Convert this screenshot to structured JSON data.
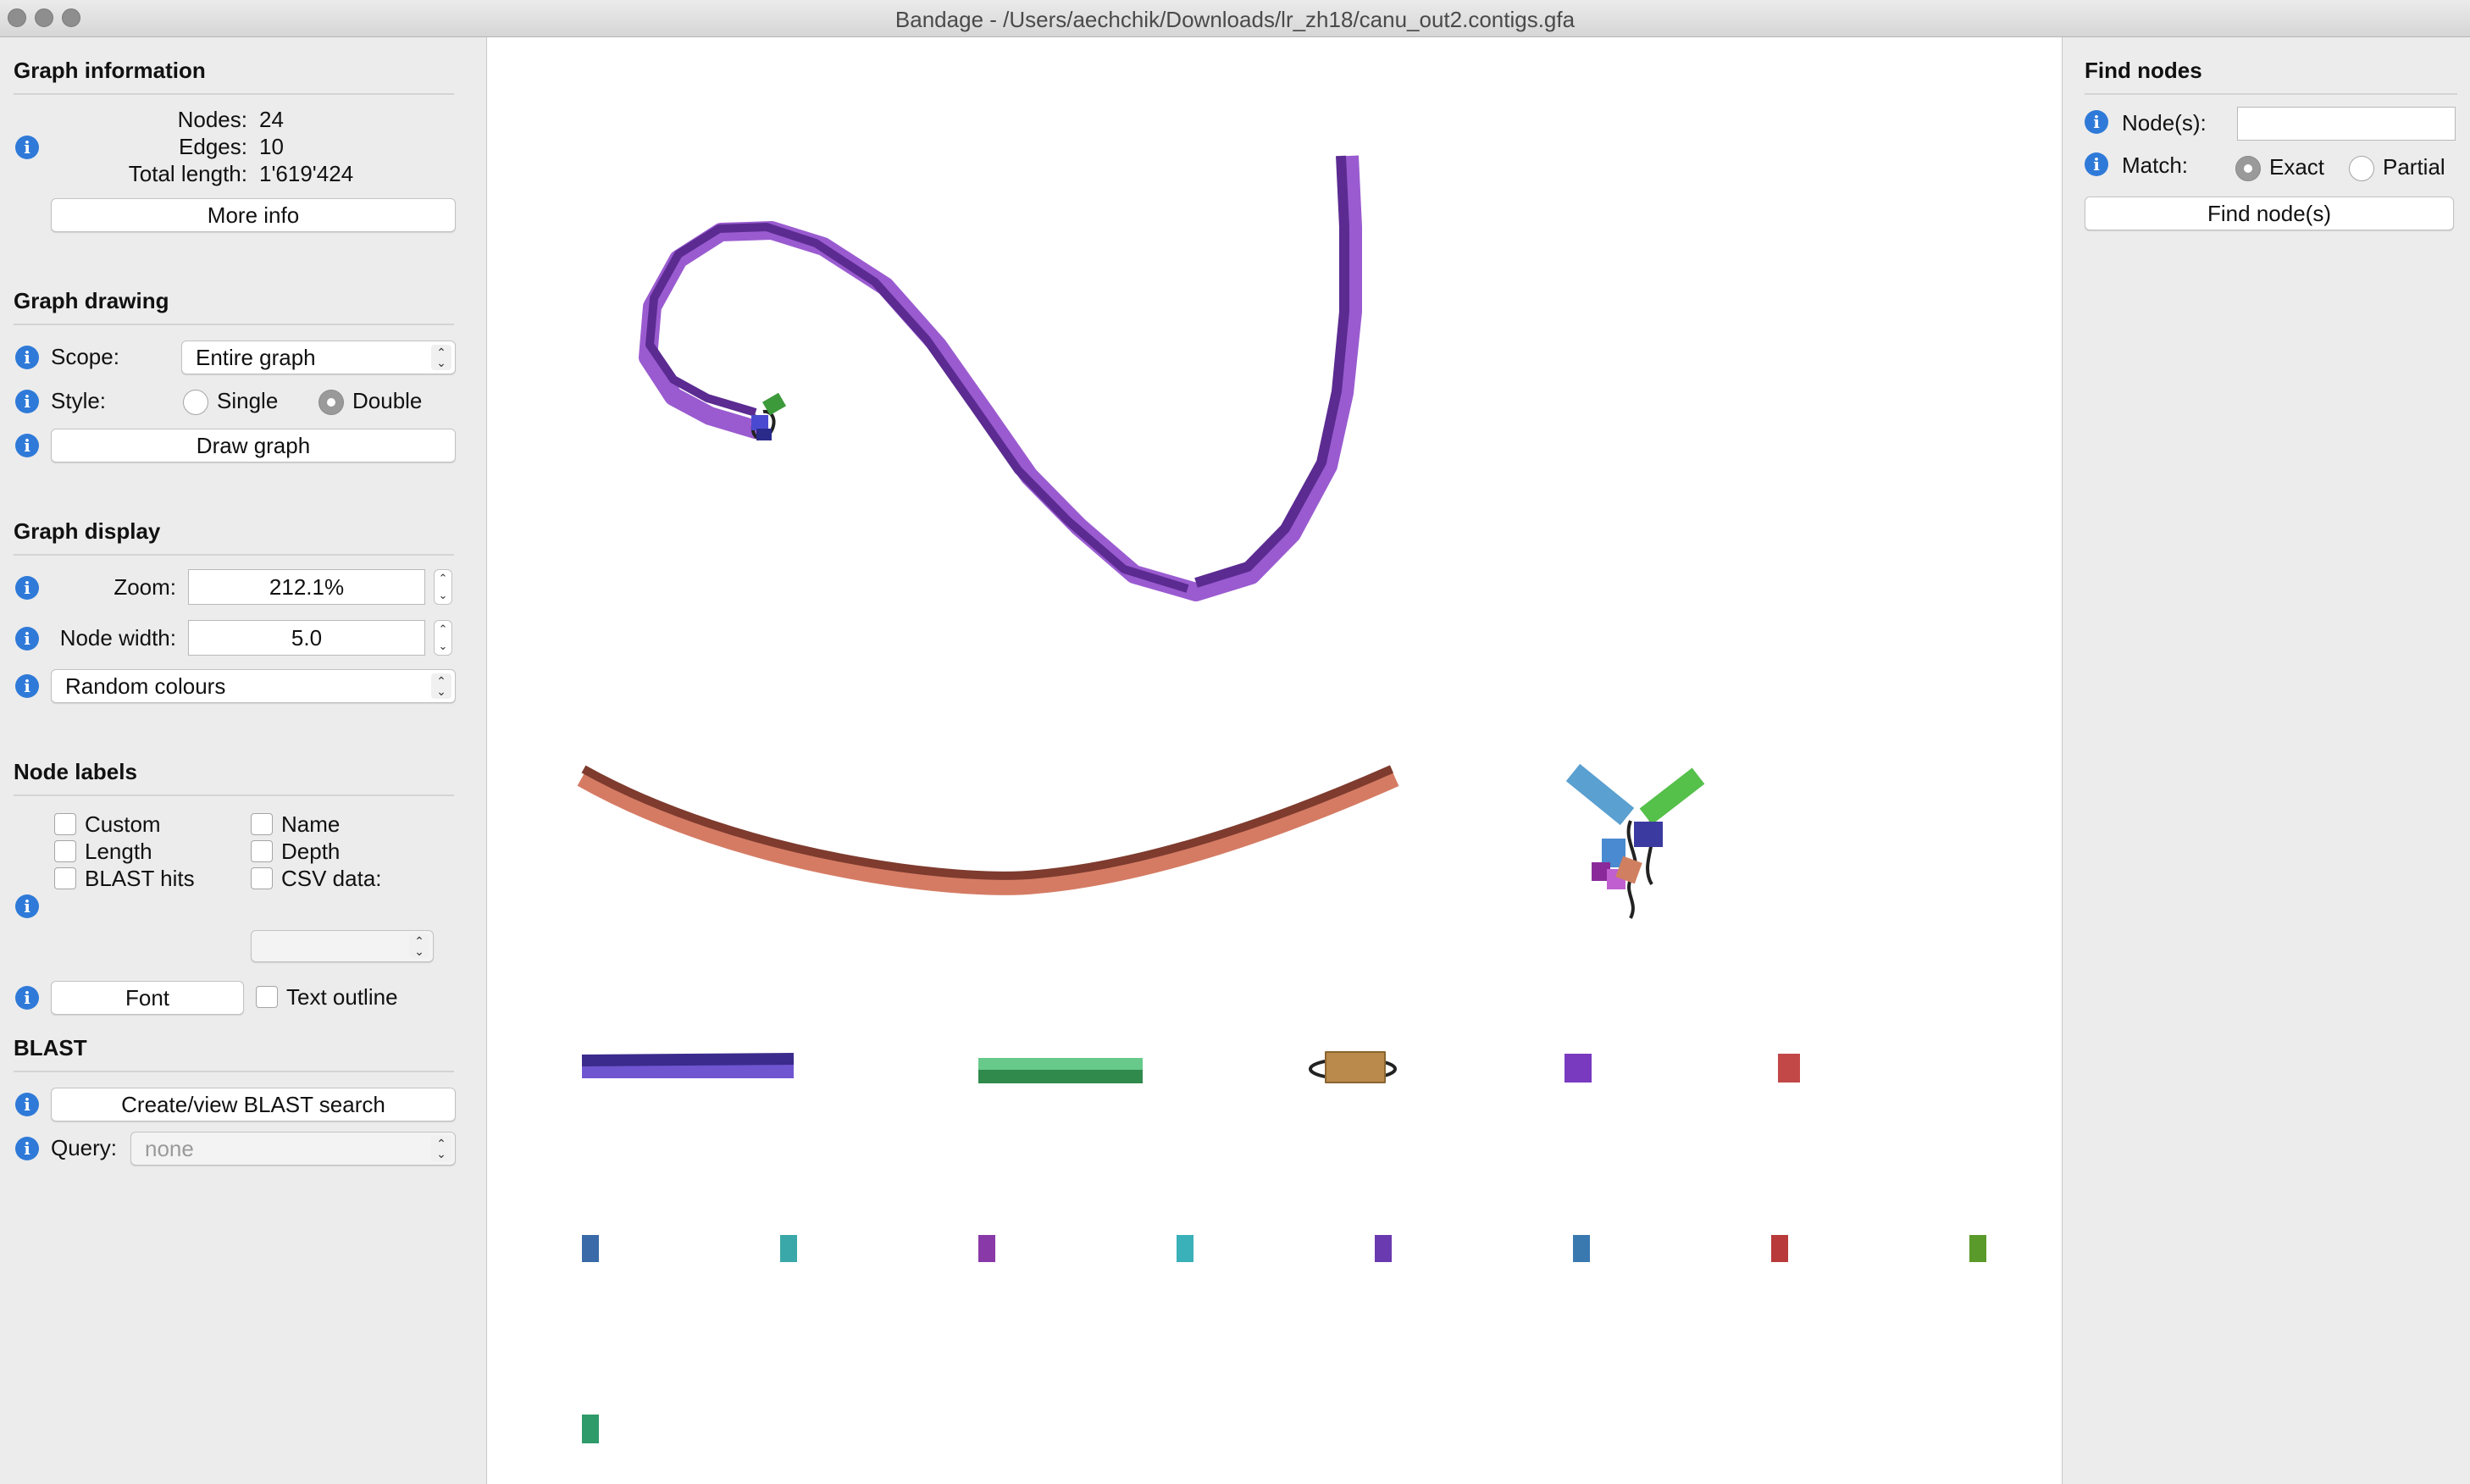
{
  "window": {
    "title": "Bandage - /Users/aechchik/Downloads/lr_zh18/canu_out2.contigs.gfa",
    "traffic_light_color": "#8e8e8e"
  },
  "left_panel": {
    "graph_information": {
      "title": "Graph information",
      "nodes_label": "Nodes:",
      "nodes_value": "24",
      "edges_label": "Edges:",
      "edges_value": "10",
      "total_length_label": "Total length:",
      "total_length_value": "1'619'424",
      "more_info_button": "More info"
    },
    "graph_drawing": {
      "title": "Graph drawing",
      "scope_label": "Scope:",
      "scope_value": "Entire graph",
      "style_label": "Style:",
      "style_single": "Single",
      "style_double": "Double",
      "style_selected": "Double",
      "draw_button": "Draw graph"
    },
    "graph_display": {
      "title": "Graph display",
      "zoom_label": "Zoom:",
      "zoom_value": "212.1%",
      "node_width_label": "Node width:",
      "node_width_value": "5.0",
      "colour_scheme": "Random colours"
    },
    "node_labels": {
      "title": "Node labels",
      "custom": "Custom",
      "length": "Length",
      "blast_hits": "BLAST hits",
      "name": "Name",
      "depth": "Depth",
      "csv_data": "CSV data:",
      "font_button": "Font",
      "text_outline": "Text outline"
    },
    "blast": {
      "title": "BLAST",
      "create_button": "Create/view BLAST search",
      "query_label": "Query:",
      "query_value": "none"
    }
  },
  "right_panel": {
    "title": "Find nodes",
    "nodes_label": "Node(s):",
    "nodes_input_value": "",
    "match_label": "Match:",
    "match_exact": "Exact",
    "match_partial": "Partial",
    "match_selected": "Exact",
    "find_button": "Find node(s)"
  },
  "info_icon_color": "#2f7ad8",
  "graph_colors": {
    "contig_purple_dark": "#5b2b91",
    "contig_purple_light": "#9a5bd0",
    "contig_brown_dark": "#7e3b2e",
    "contig_brown_light": "#d57b64",
    "contig_indigo_dark": "#3b2b8c",
    "contig_indigo_light": "#6f55d0",
    "contig_green_dark": "#2f8a4c",
    "contig_green_light": "#67c98a",
    "contig_tan": "#b98a4c",
    "edge_color": "#222222"
  }
}
